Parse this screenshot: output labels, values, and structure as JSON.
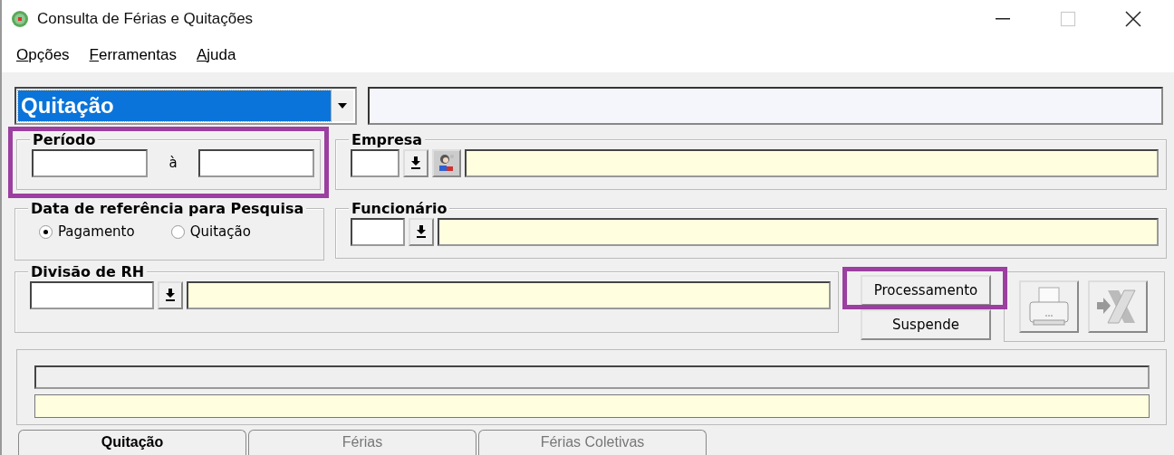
{
  "window": {
    "title": "Consulta de Férias e Quitações"
  },
  "menu": [
    {
      "label": "Opções"
    },
    {
      "label": "Ferramentas"
    },
    {
      "label": "Ajuda"
    }
  ],
  "selector": {
    "value": "Quitação"
  },
  "period": {
    "label": "Período",
    "separator": "à",
    "highlighted": true
  },
  "company": {
    "label": "Empresa"
  },
  "reference": {
    "label": "Data de referência para Pesquisa",
    "options": [
      {
        "label": "Pagamento",
        "selected": true
      },
      {
        "label": "Quitação",
        "selected": false
      }
    ]
  },
  "employee": {
    "label": "Funcionário"
  },
  "division": {
    "label": "Divisão de RH"
  },
  "buttons": [
    {
      "label": "Processamento",
      "highlighted": true
    },
    {
      "label": "Suspende",
      "highlighted": false
    }
  ],
  "tabs": [
    {
      "label": "Quitação",
      "selected": true
    },
    {
      "label": "Férias",
      "selected": false
    },
    {
      "label": "Férias Coletivas",
      "selected": false
    }
  ]
}
